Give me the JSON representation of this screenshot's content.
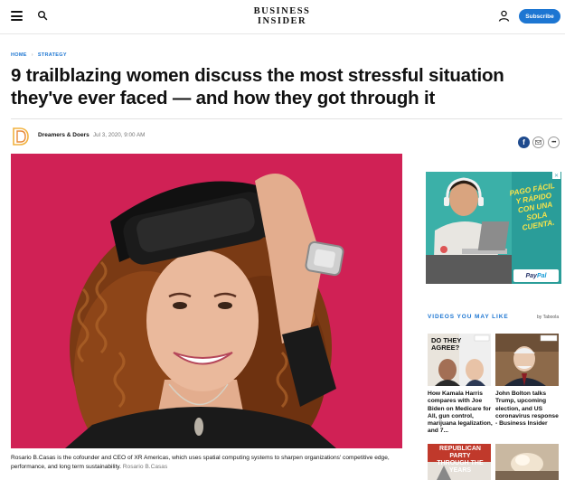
{
  "header": {
    "logo_line1": "BUSINESS",
    "logo_line2": "INSIDER",
    "subscribe_label": "Subscribe"
  },
  "breadcrumb": {
    "home": "HOME",
    "section": "STRATEGY"
  },
  "article": {
    "headline": "9 trailblazing women discuss the most stressful situation they've ever faced — and how they got through it",
    "author": "Dreamers & Doers",
    "date": "Jul 3, 2020, 9:00 AM",
    "caption": "Rosario B.Casas is the cofounder and CEO of XR Americas, which uses spatial computing systems to sharpen organizations' competitive edge, performance, and long term sustainability.",
    "credit": "Rosario B.Casas"
  },
  "share": {
    "facebook_icon": "facebook-icon",
    "email_icon": "email-icon",
    "more_icon": "more-icon"
  },
  "ad": {
    "text": "PAGO FÁCIL Y RÁPIDO CON UNA SOLA CUENTA.",
    "brand_part1": "Pay",
    "brand_part2": "Pal"
  },
  "videos": {
    "heading": "VIDEOS YOU MAY LIKE",
    "by": "by Taboola",
    "items": [
      {
        "title": "How Kamala Harris compares with Joe Biden on Medicare for All, gun control, marijuana legalization, and 7...",
        "thumb_text": "DO THEY AGREE?"
      },
      {
        "title": "John Bolton talks Trump, upcoming election, and US coronavirus response - Business Insider",
        "thumb_text": ""
      },
      {
        "title": "",
        "thumb_text": "REPUBLICAN PARTY THROUGH THE YEARS"
      },
      {
        "title": "",
        "thumb_text": ""
      }
    ]
  },
  "colors": {
    "accent": "#1d76d2",
    "hero_bg": "#d32452",
    "ad_bg": "#2a9d99",
    "ad_text": "#f8e34a"
  }
}
